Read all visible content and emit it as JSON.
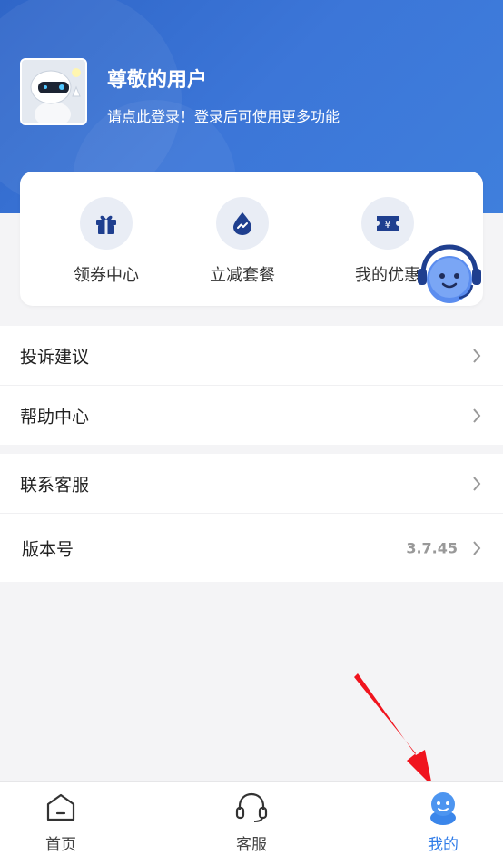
{
  "header": {
    "user_name": "尊敬的用户",
    "login_prompt": "请点此登录！登录后可使用更多功能"
  },
  "quick_actions": [
    {
      "label": "领券中心",
      "icon": "gift-icon"
    },
    {
      "label": "立减套餐",
      "icon": "trend-drop-icon"
    },
    {
      "label": "我的优惠",
      "icon": "yen-ticket-icon"
    }
  ],
  "menu_group1": [
    {
      "label": "投诉建议"
    },
    {
      "label": "帮助中心"
    }
  ],
  "menu_group2": [
    {
      "label": "联系客服"
    },
    {
      "label": "版本号",
      "value": "3.7.45"
    }
  ],
  "tabbar": [
    {
      "label": "首页",
      "icon": "home-icon"
    },
    {
      "label": "客服",
      "icon": "headset-icon"
    },
    {
      "label": "我的",
      "icon": "user-icon",
      "active": true
    }
  ],
  "colors": {
    "header_blue": "#3c76d8",
    "icon_navy": "#1f3f8f",
    "active_tab": "#2f7be8",
    "arrow_red": "#f0141e"
  }
}
